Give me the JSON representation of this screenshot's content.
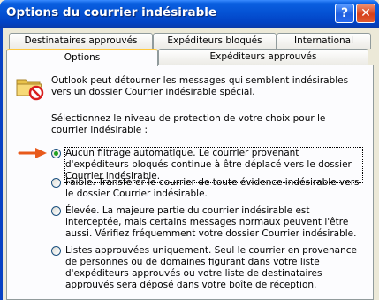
{
  "window": {
    "title": "Options du courrier indésirable",
    "help_label": "?",
    "close_label": "✕"
  },
  "tabs": {
    "row1": [
      {
        "label": "Destinataires approuvés"
      },
      {
        "label": "Expéditeurs bloqués"
      },
      {
        "label": "International"
      }
    ],
    "row2": [
      {
        "label": "Options",
        "active": true
      },
      {
        "label": "Expéditeurs approuvés"
      }
    ]
  },
  "content": {
    "intro": "Outlook peut détourner les messages qui semblent indésirables vers un dossier Courrier indésirable spécial.",
    "instructions": "Sélectionnez le niveau de protection de votre choix pour le courrier indésirable :",
    "selected_option": "aucun",
    "options": [
      {
        "id": "aucun",
        "label": "Aucun filtrage automatique. Le courrier provenant d'expéditeurs bloqués continue à être déplacé vers le dossier Courrier indésirable."
      },
      {
        "id": "faible",
        "label": "Faible. Transférer le courrier de toute évidence indésirable vers le dossier Courrier indésirable."
      },
      {
        "id": "elevee",
        "label": "Élevée. La majeure partie du courrier indésirable est interceptée, mais certains messages normaux peuvent l'être aussi. Vérifiez fréquemment votre dossier Courrier indésirable."
      },
      {
        "id": "listes",
        "label": "Listes approuvées uniquement. Seul le courrier en provenance de personnes ou de domaines figurant dans votre liste d'expéditeurs approuvés ou votre liste de destinataires approuvés sera déposé dans votre boîte de réception."
      }
    ]
  },
  "colors": {
    "title_bar": "#0452d4",
    "window_bg": "#ece9d8",
    "arrow": "#e85a1c",
    "radio_checked": "#21a121"
  },
  "icons": [
    "folder-icon",
    "no-sign-icon",
    "pointer-arrow-icon"
  ]
}
